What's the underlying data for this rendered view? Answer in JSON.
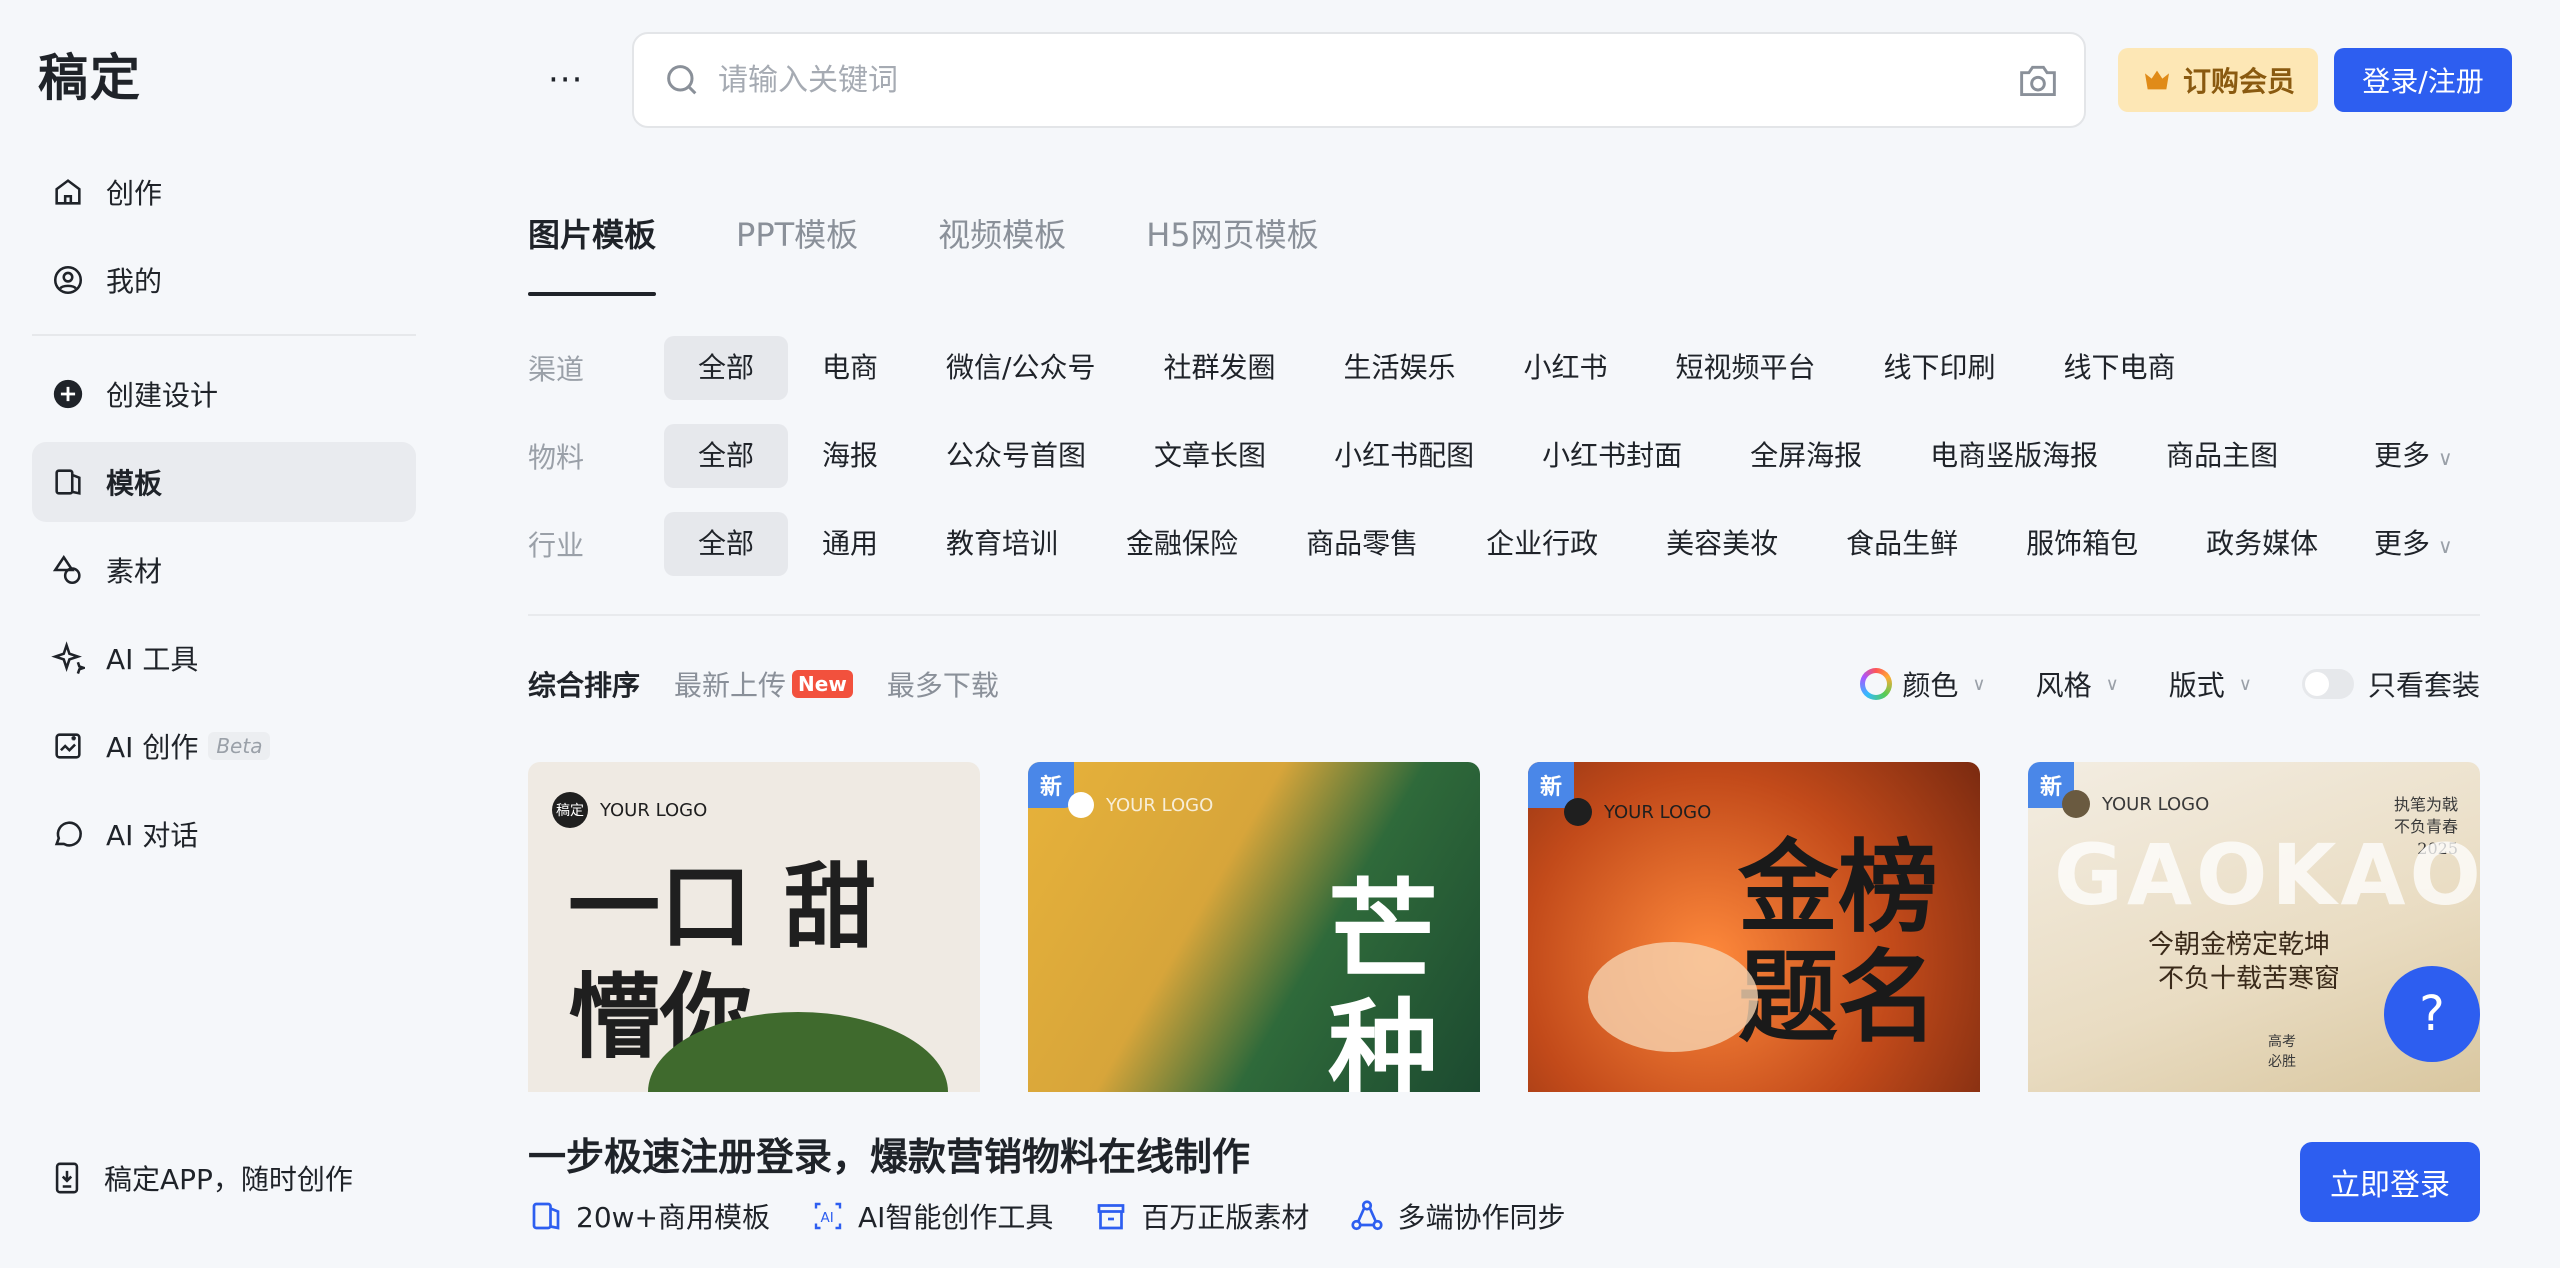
{
  "app": {
    "logo": "稿定"
  },
  "sidebar": {
    "items": [
      {
        "label": "创作",
        "icon": "home-icon"
      },
      {
        "label": "我的",
        "icon": "user-icon"
      },
      {
        "label": "创建设计",
        "icon": "plus-circle-icon"
      },
      {
        "label": "模板",
        "icon": "template-icon",
        "active": true
      },
      {
        "label": "素材",
        "icon": "shapes-icon"
      },
      {
        "label": "AI 工具",
        "icon": "sparkle-icon"
      },
      {
        "label": "AI 创作",
        "icon": "ai-create-icon",
        "badge": "Beta"
      },
      {
        "label": "AI 对话",
        "icon": "chat-icon"
      }
    ],
    "app_download": "稿定APP，随时创作"
  },
  "header": {
    "search_placeholder": "请输入关键词",
    "vip_label": "订购会员",
    "login_label": "登录/注册"
  },
  "tabs": [
    "图片模板",
    "PPT模板",
    "视频模板",
    "H5网页模板"
  ],
  "filters": {
    "channel": {
      "label": "渠道",
      "options": [
        "全部",
        "电商",
        "微信/公众号",
        "社群发圈",
        "生活娱乐",
        "小红书",
        "短视频平台",
        "线下印刷",
        "线下电商"
      ]
    },
    "material": {
      "label": "物料",
      "options": [
        "全部",
        "海报",
        "公众号首图",
        "文章长图",
        "小红书配图",
        "小红书封面",
        "全屏海报",
        "电商竖版海报",
        "商品主图"
      ],
      "more": "更多"
    },
    "industry": {
      "label": "行业",
      "options": [
        "全部",
        "通用",
        "教育培训",
        "金融保险",
        "商品零售",
        "企业行政",
        "美容美妆",
        "食品生鲜",
        "服饰箱包",
        "政务媒体"
      ],
      "more": "更多"
    }
  },
  "sort": {
    "options": [
      "综合排序",
      "最新上传",
      "最多下载"
    ],
    "new_badge": "New",
    "color": "颜色",
    "style": "风格",
    "layout": "版式",
    "suite_only": "只看套装"
  },
  "cards": [
    {
      "brand": "YOUR LOGO",
      "logo_text": "稿定",
      "title": "一口 甜懵你"
    },
    {
      "badge": "新",
      "brand": "YOUR LOGO",
      "title": "芒种"
    },
    {
      "badge": "新",
      "brand": "YOUR LOGO",
      "title": "金榜题名"
    },
    {
      "badge": "新",
      "brand": "YOUR LOGO",
      "title": "GAOKAO",
      "line1": "今朝金榜定乾坤",
      "line2": "不负十载苦寒窗",
      "side": "执笔为戟 不负青春 2025",
      "sub": "高考 必胜"
    }
  ],
  "banner": {
    "title": "一步极速注册登录，爆款营销物料在线制作",
    "features": [
      "20w+商用模板",
      "AI智能创作工具",
      "百万正版素材",
      "多端协作同步"
    ],
    "cta": "立即登录"
  },
  "help": "?"
}
